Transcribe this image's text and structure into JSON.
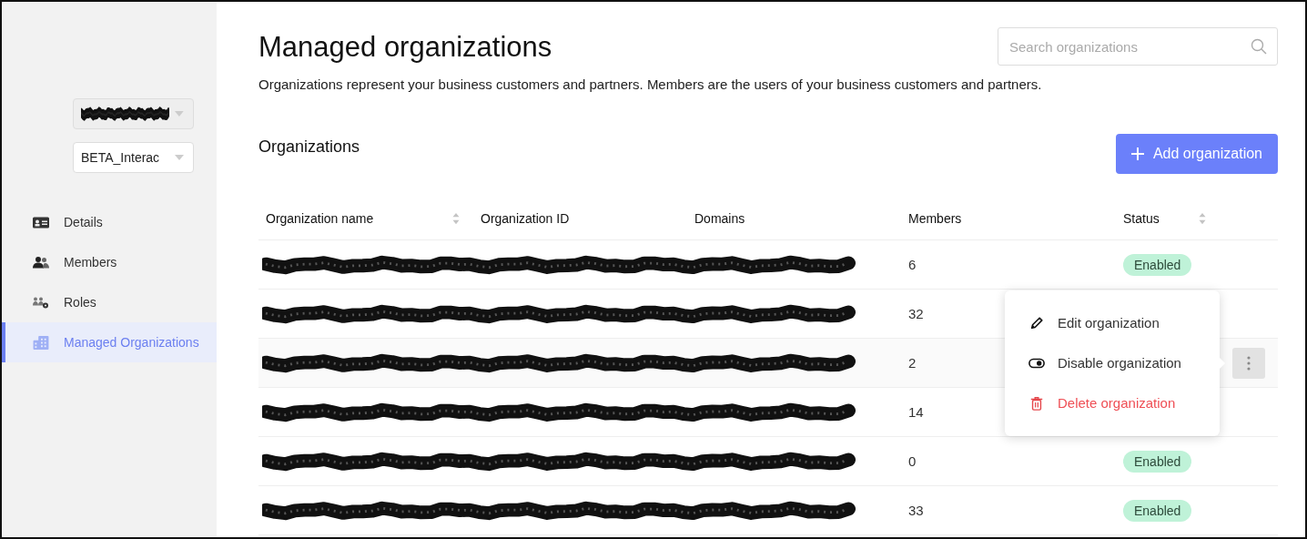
{
  "sidebar": {
    "selectors": [
      {
        "value": "BETA_Interac"
      }
    ],
    "items": [
      {
        "label": "Details",
        "selected": false
      },
      {
        "label": "Members",
        "selected": false
      },
      {
        "label": "Roles",
        "selected": false
      },
      {
        "label": "Managed Organizations",
        "selected": true
      }
    ]
  },
  "page": {
    "title": "Managed organizations",
    "description": "Organizations represent your business customers and partners. Members are the users of your business customers and partners.",
    "search": {
      "placeholder": "Search organizations"
    }
  },
  "section": {
    "title": "Organizations",
    "add_button": "Add organization"
  },
  "table": {
    "columns": [
      {
        "label": "Organization name",
        "sortable": true
      },
      {
        "label": "Organization ID",
        "sortable": false
      },
      {
        "label": "Domains",
        "sortable": false
      },
      {
        "label": "Members",
        "sortable": false
      },
      {
        "label": "Status",
        "sortable": true
      }
    ],
    "rows": [
      {
        "members": "6",
        "status": "Enabled",
        "menu_open": false
      },
      {
        "members": "32",
        "menu_open": false
      },
      {
        "members": "2",
        "menu_open": true
      },
      {
        "members": "14",
        "menu_open": false
      },
      {
        "members": "0",
        "status": "Enabled",
        "menu_open": false
      },
      {
        "members": "33",
        "status": "Enabled",
        "menu_open": false
      }
    ]
  },
  "row_menu": {
    "items": [
      {
        "label": "Edit organization",
        "kind": "edit"
      },
      {
        "label": "Disable organization",
        "kind": "toggle"
      },
      {
        "label": "Delete organization",
        "kind": "delete"
      }
    ]
  }
}
